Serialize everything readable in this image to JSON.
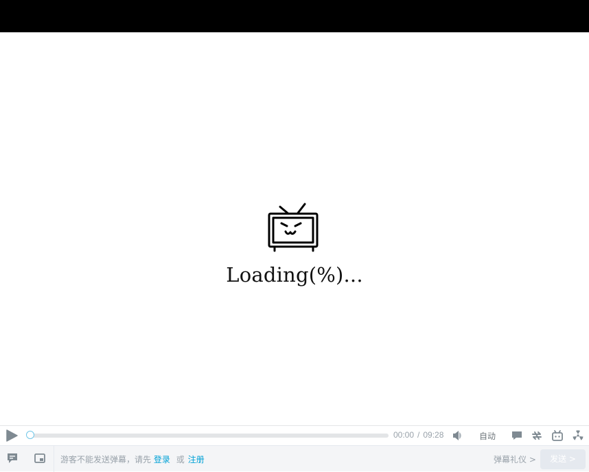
{
  "player": {
    "loading_text": "Loading(%)...",
    "logo_icon": "bilibili-tv-icon"
  },
  "controls": {
    "play_icon": "play-icon",
    "progress": 0.0,
    "current_time": "00:00",
    "time_separator": "/",
    "duration": "09:28",
    "volume_icon": "volume-icon",
    "quality_label": "自动",
    "danmaku_toggle_icon": "danmaku-icon",
    "loop_icon": "loop-icon",
    "widescreen_icon": "bilibili-tv-icon",
    "fullscreen_icon": "radiation-icon",
    "accent_color": "#00a1d6"
  },
  "danmaku_bar": {
    "danmaku_list_icon": "comment-icon",
    "pip_icon": "picture-in-picture-icon",
    "notice_prefix": "游客不能发送弹幕，请先",
    "login_link": "登录",
    "or_text": "或",
    "register_link": "注册",
    "etiquette_label": "弹幕礼仪 >",
    "send_label": "发送 >"
  }
}
